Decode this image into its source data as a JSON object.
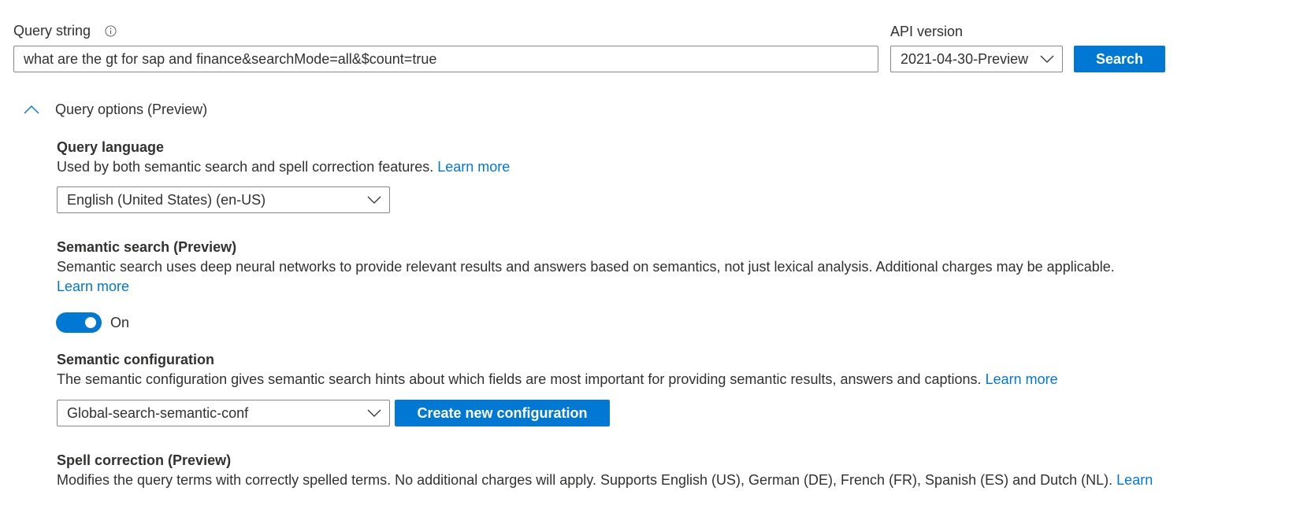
{
  "query": {
    "label": "Query string",
    "value": "what are the gt for sap and finance&searchMode=all&$count=true",
    "info_icon": "info-icon"
  },
  "api": {
    "label": "API version",
    "selected": "2021-04-30-Preview"
  },
  "search_button": "Search",
  "options": {
    "toggle_label": "Query options (Preview)",
    "expanded": true,
    "query_language": {
      "heading": "Query language",
      "description": "Used by both semantic search and spell correction features.",
      "link": "Learn more",
      "selected": "English (United States) (en-US)"
    },
    "semantic_search": {
      "heading": "Semantic search (Preview)",
      "description": "Semantic search uses deep neural networks to provide relevant results and answers based on semantics, not just lexical analysis. Additional charges may be applicable.",
      "link": "Learn more",
      "toggle_state": "On"
    },
    "semantic_config": {
      "heading": "Semantic configuration",
      "description": "The semantic configuration gives semantic search hints about which fields are most important for providing semantic results, answers and captions.",
      "link": "Learn more",
      "selected": "Global-search-semantic-conf",
      "create_button": "Create new configuration"
    },
    "spell_correction": {
      "heading": "Spell correction (Preview)",
      "description": "Modifies the query terms with correctly spelled terms. No additional charges will apply. Supports English (US), German (DE), French (FR), Spanish (ES) and Dutch (NL).",
      "link": "Learn"
    }
  },
  "colors": {
    "accent": "#0078d4",
    "text": "#323130",
    "border": "#8a8886"
  }
}
